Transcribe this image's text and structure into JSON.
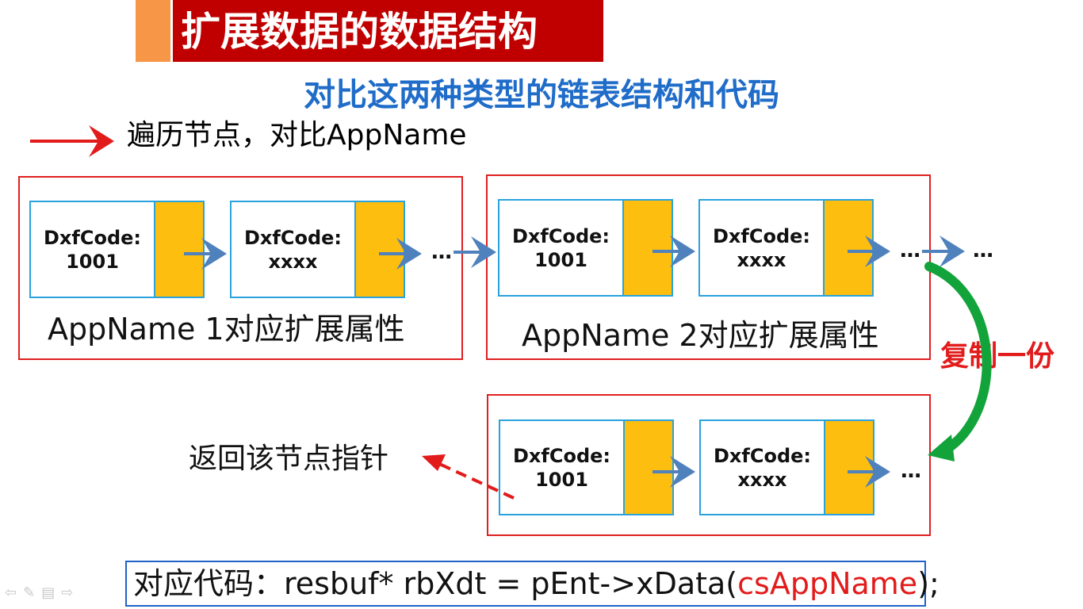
{
  "slide": {
    "title": "扩展数据的数据结构",
    "subtitle": "对比这两种类型的链表结构和代码"
  },
  "legend": {
    "text": "遍历节点，对比AppName"
  },
  "groups": [
    {
      "label": "AppName 1对应扩展属性",
      "nodes": [
        {
          "code_label": "DxfCode:",
          "code_value": "1001"
        },
        {
          "code_label": "DxfCode:",
          "code_value": "xxxx"
        }
      ],
      "trailing": "…"
    },
    {
      "label": "AppName 2对应扩展属性",
      "nodes": [
        {
          "code_label": "DxfCode:",
          "code_value": "1001"
        },
        {
          "code_label": "DxfCode:",
          "code_value": "xxxx"
        }
      ],
      "trailing": "…",
      "after": "…"
    },
    {
      "label": "",
      "nodes": [
        {
          "code_label": "DxfCode:",
          "code_value": "1001"
        },
        {
          "code_label": "DxfCode:",
          "code_value": "xxxx"
        }
      ],
      "trailing": "…"
    }
  ],
  "copy_label": "复制一份",
  "return_label": "返回该节点指针",
  "code": {
    "prefix": "对应代码：resbuf* rbXdt = pEnt->xData(",
    "arg": "csAppName",
    "suffix": ");"
  },
  "colors": {
    "title_bg": "#c00000",
    "title_accent": "#f79646",
    "subtitle": "#1f6cc9",
    "frame": "#e02020",
    "node_border": "#2aa3dc",
    "node_pointer": "#fdbe10",
    "arrow_blue": "#4f81bd",
    "arrow_red": "#e21b1b",
    "arrow_green": "#12a33a"
  },
  "nav_icons": [
    "prev-icon",
    "pen-icon",
    "menu-icon",
    "next-icon"
  ]
}
